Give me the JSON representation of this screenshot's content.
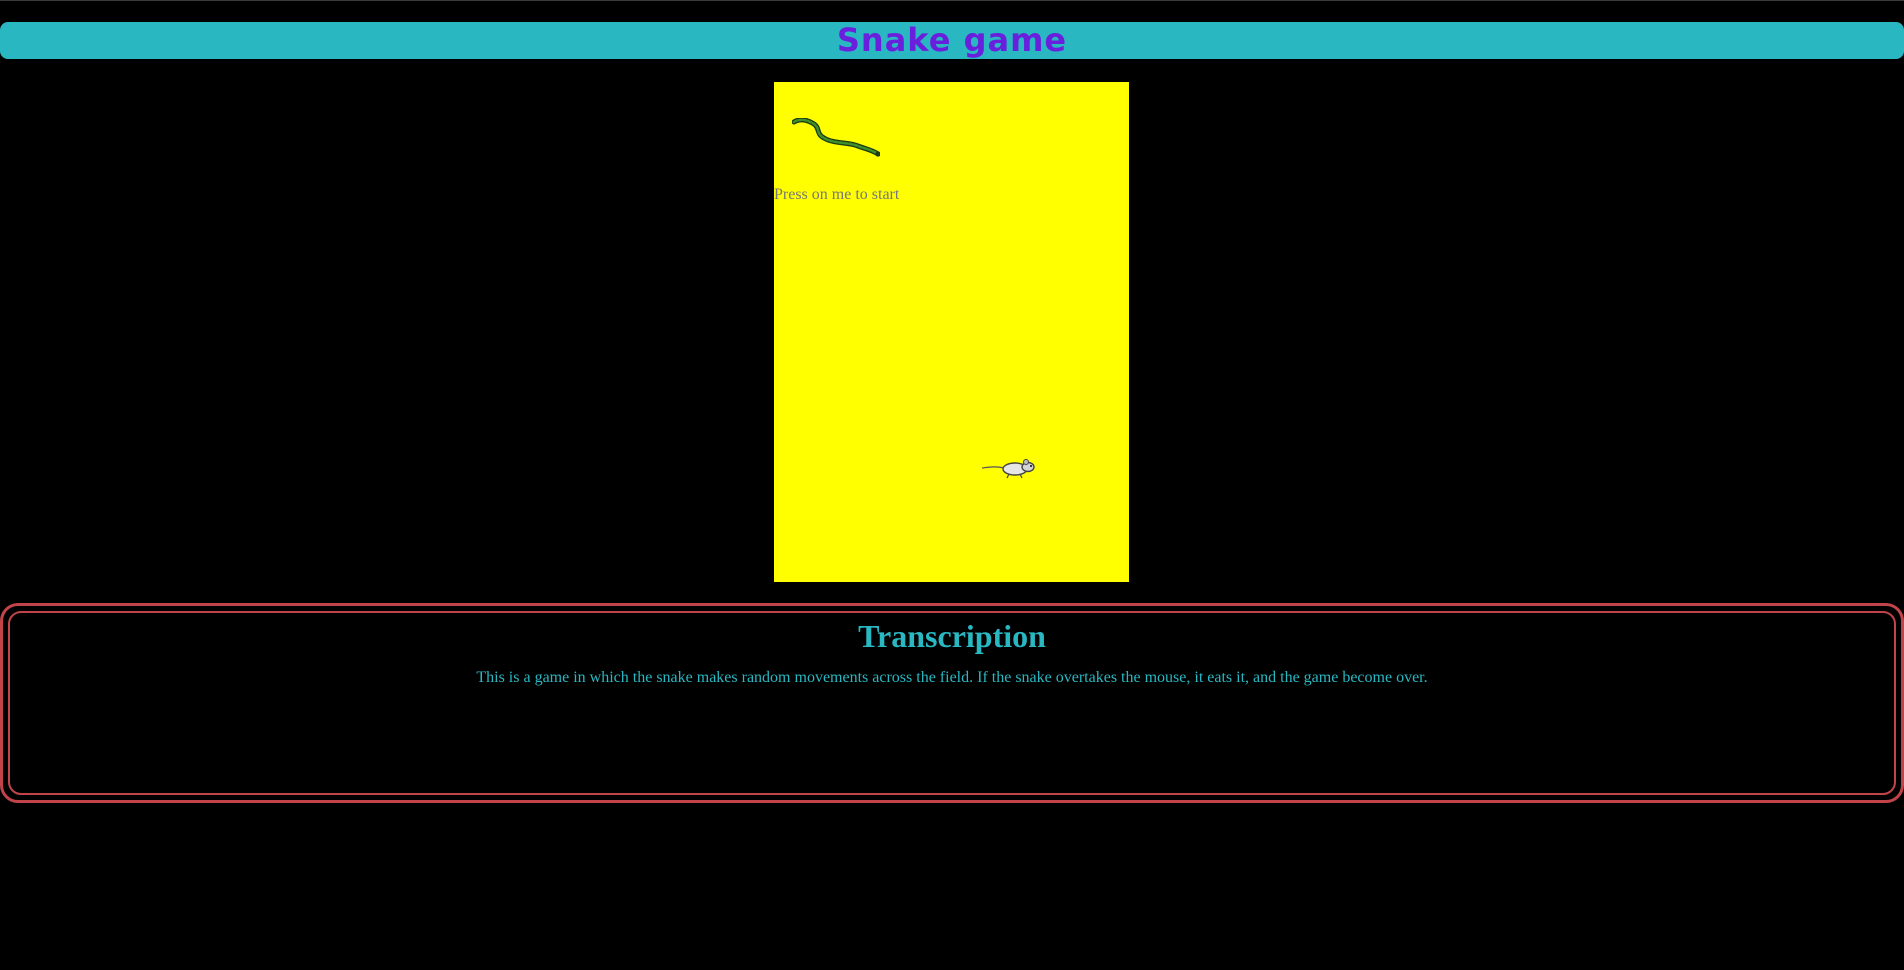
{
  "header": {
    "title": "Snake game"
  },
  "game": {
    "start_prompt": "Press on me to start",
    "field_color": "#ffff00",
    "snake_icon": "snake-icon",
    "mouse_icon": "mouse-icon"
  },
  "transcription": {
    "heading": "Transcription",
    "text": "This is a game in which the snake makes random movements across the field. If the snake overtakes the mouse, it eats it, and the game become over."
  },
  "colors": {
    "background": "#000000",
    "header_bar": "#29b7c2",
    "title": "#6a1fdc",
    "border": "#c0444a",
    "transcription_text": "#29b7c2"
  }
}
